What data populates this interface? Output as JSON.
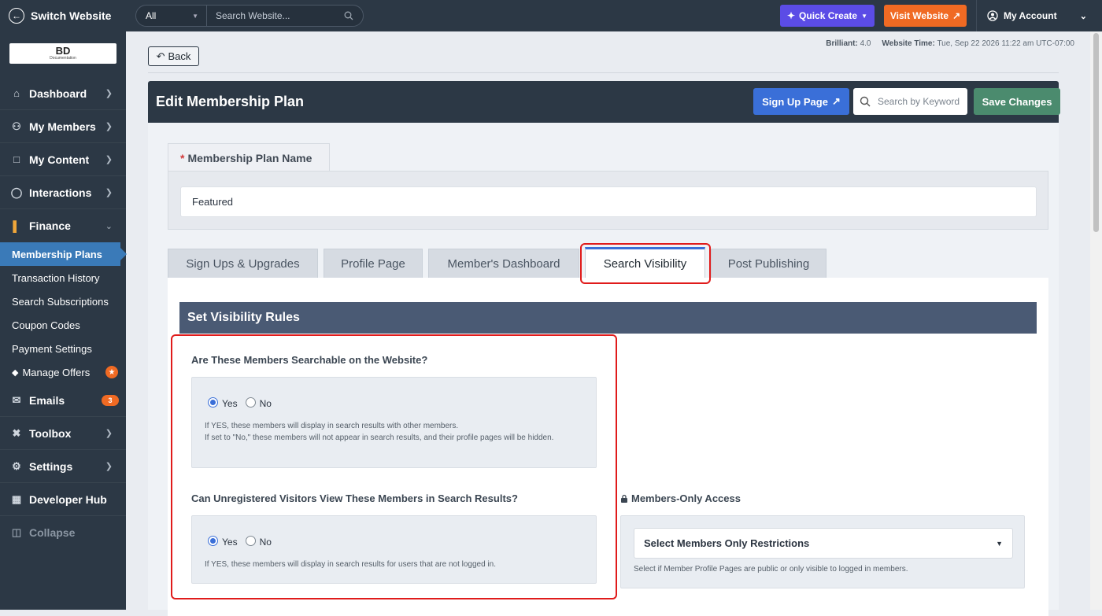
{
  "topbar": {
    "switch_label": "Switch Website",
    "search_scope": "All",
    "search_placeholder": "Search Website...",
    "quick_create": "Quick Create",
    "visit_website": "Visit Website",
    "account": "My Account"
  },
  "sidebar": {
    "logo_text": "BD",
    "logo_sub": "Documentation",
    "items": [
      {
        "label": "Dashboard",
        "icon": "home-icon"
      },
      {
        "label": "My Members",
        "icon": "users-icon"
      },
      {
        "label": "My Content",
        "icon": "folder-icon"
      },
      {
        "label": "Interactions",
        "icon": "chat-icon"
      },
      {
        "label": "Finance",
        "icon": "chart-icon"
      }
    ],
    "finance_sub": [
      "Membership Plans",
      "Transaction History",
      "Search Subscriptions",
      "Coupon Codes",
      "Payment Settings",
      "Manage Offers"
    ],
    "emails": "Emails",
    "emails_badge": "3",
    "toolbox": "Toolbox",
    "settings": "Settings",
    "developer_hub": "Developer Hub",
    "collapse": "Collapse"
  },
  "main": {
    "back": "Back",
    "meta_version_label": "Brilliant:",
    "meta_version": "4.0",
    "meta_time_label": "Website Time:",
    "meta_time": "Tue, Sep 22 2026 11:22 am UTC-07:00",
    "title": "Edit Membership Plan",
    "signup_page": "Sign Up Page",
    "keyword_placeholder": "Search by Keyword",
    "save": "Save Changes",
    "plan_name_label": "Membership Plan Name",
    "plan_name_value": "Featured",
    "tabs": [
      "Sign Ups & Upgrades",
      "Profile Page",
      "Member's Dashboard",
      "Search Visibility",
      "Post Publishing"
    ],
    "section_title": "Set Visibility Rules",
    "q1": "Are These Members Searchable on the Website?",
    "q1_help1": "If YES, these members will display in search results with other members.",
    "q1_help2": "If set to \"No,\" these members will not appear in search results, and their profile pages will be hidden.",
    "q2": "Can Unregistered Visitors View These Members in Search Results?",
    "q2_help": "If YES, these members will display in search results for users that are not logged in.",
    "yes": "Yes",
    "no": "No",
    "members_only_label": "Members-Only Access",
    "members_only_select": "Select Members Only Restrictions",
    "members_only_help": "Select if Member Profile Pages are public or only visible to logged in members."
  },
  "colors": {
    "sidebar": "#2c3845",
    "accent": "#3a6fd8",
    "orange": "#f06a23",
    "save": "#4b8b6e",
    "highlight": "#e01b1b"
  }
}
